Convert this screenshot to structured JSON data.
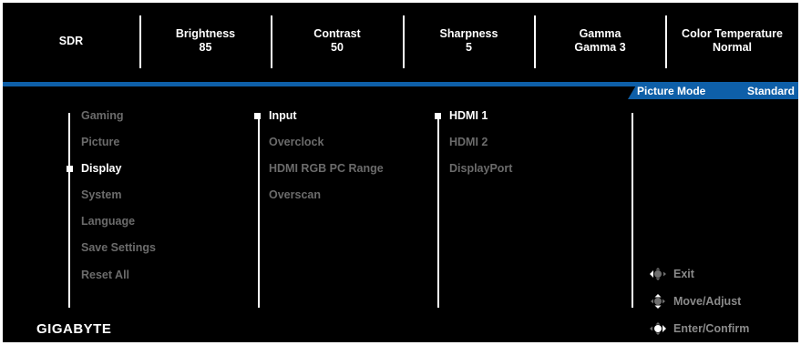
{
  "top_bar": {
    "items": [
      {
        "label": "SDR",
        "value": ""
      },
      {
        "label": "Brightness",
        "value": "85"
      },
      {
        "label": "Contrast",
        "value": "50"
      },
      {
        "label": "Sharpness",
        "value": "5"
      },
      {
        "label": "Gamma",
        "value": "Gamma 3"
      },
      {
        "label": "Color Temperature",
        "value": "Normal"
      }
    ]
  },
  "picture_mode": {
    "label": "Picture Mode",
    "value": "Standard"
  },
  "main_menu": [
    "Gaming",
    "Picture",
    "Display",
    "System",
    "Language",
    "Save Settings",
    "Reset All"
  ],
  "main_menu_selected": "Display",
  "sub_menu": [
    "Input",
    "Overclock",
    "HDMI RGB PC Range",
    "Overscan"
  ],
  "sub_menu_selected": "Input",
  "options": [
    "HDMI 1",
    "HDMI 2",
    "DisplayPort"
  ],
  "options_selected": "HDMI 1",
  "hints": {
    "exit": "Exit",
    "move": "Move/Adjust",
    "enter": "Enter/Confirm"
  },
  "brand": "GIGABYTE",
  "colors": {
    "accent": "#0e5fa8",
    "background": "#000000",
    "inactive_text": "#6b6b6b"
  }
}
